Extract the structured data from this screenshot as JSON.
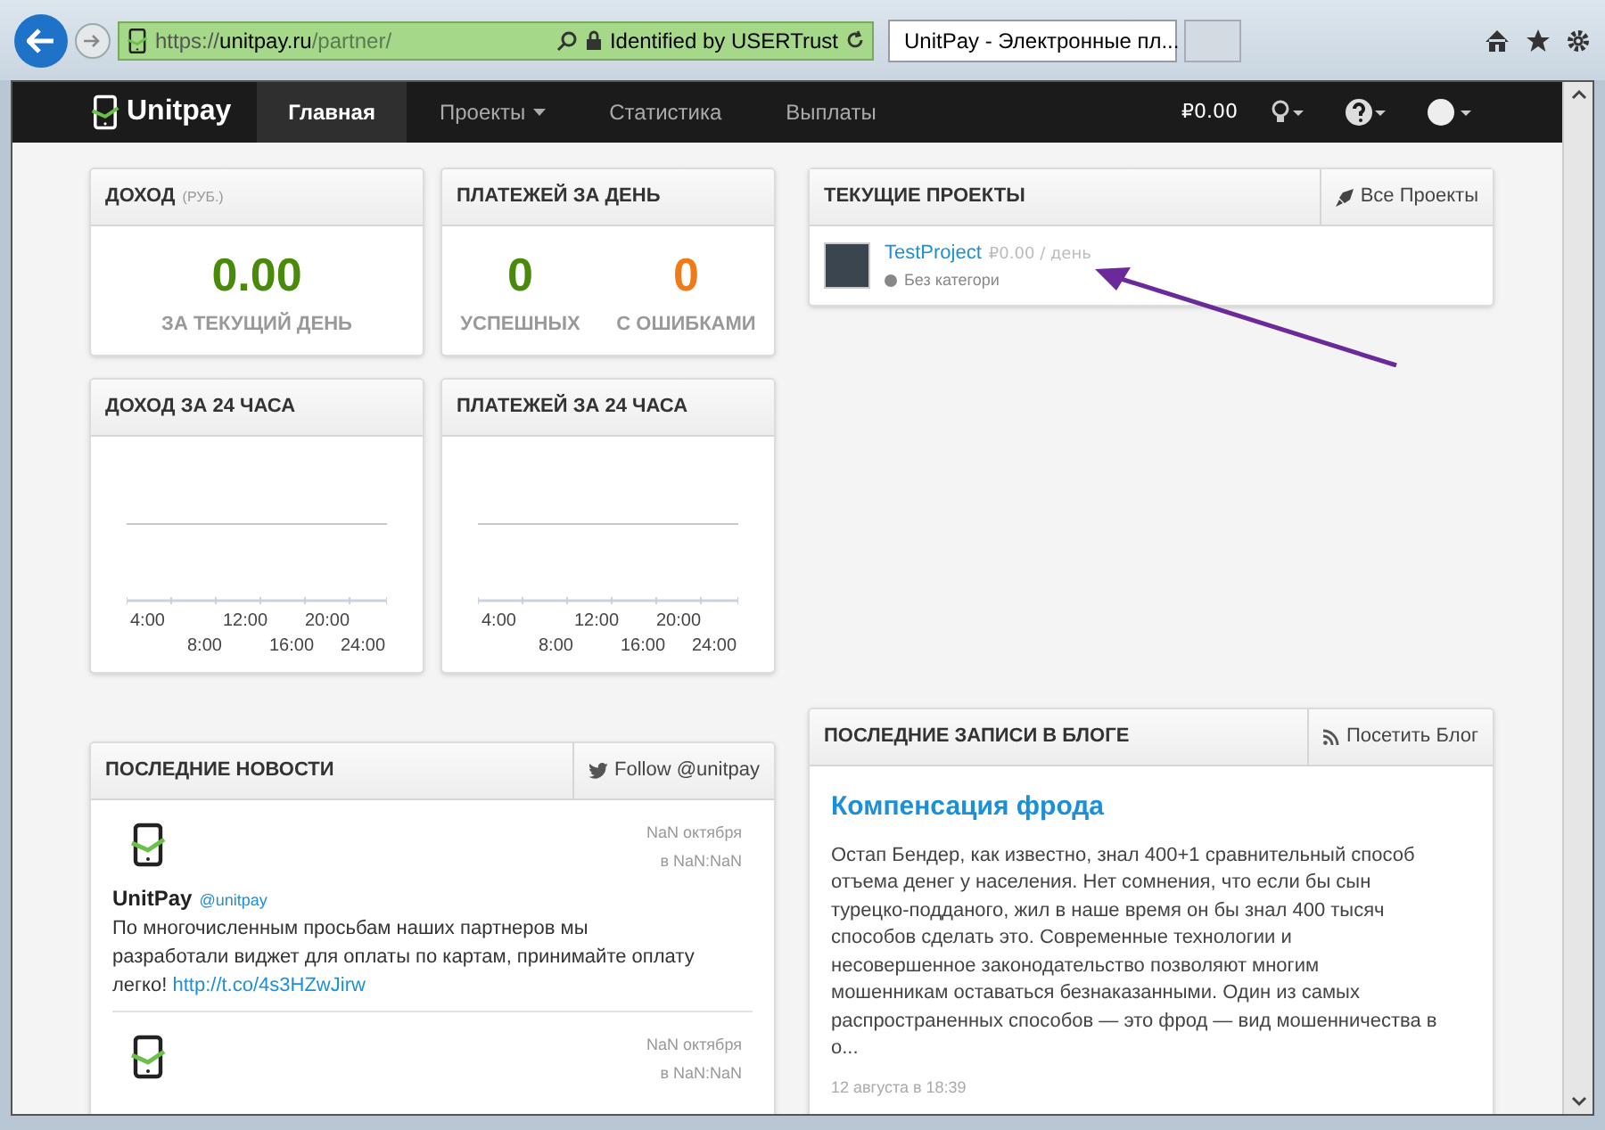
{
  "browser": {
    "address": {
      "scheme": "https://",
      "host": "unitpay.ru",
      "path": "/partner/"
    },
    "identity": "Identified by USERTrust",
    "tab": "UnitPay - Электронные пл..."
  },
  "nav": {
    "logo": "Unitpay",
    "items": [
      {
        "label": "Главная",
        "selected": true,
        "dropdown": false
      },
      {
        "label": "Проекты",
        "selected": false,
        "dropdown": true
      },
      {
        "label": "Статистика",
        "selected": false,
        "dropdown": false
      },
      {
        "label": "Выплаты",
        "selected": false,
        "dropdown": false
      }
    ],
    "balance": "₽0.00"
  },
  "income": {
    "title": "ДОХОД",
    "unit": "(РУБ.)",
    "value": "0.00",
    "caption": "ЗА ТЕКУЩИЙ ДЕНЬ"
  },
  "payments": {
    "title": "ПЛАТЕЖЕЙ ЗА ДЕНЬ",
    "stats": [
      {
        "value": "0",
        "caption": "УСПЕШНЫХ",
        "color": "#4a8a0a"
      },
      {
        "value": "0",
        "caption": "С ОШИБКАМИ",
        "color": "#f07a18"
      }
    ]
  },
  "charts": [
    {
      "title": "ДОХОД ЗА 24 ЧАСА",
      "x_labels": [
        "4:00",
        "8:00",
        "12:00",
        "16:00",
        "20:00",
        "24:00"
      ]
    },
    {
      "title": "ПЛАТЕЖЕЙ ЗА 24 ЧАСА",
      "x_labels": [
        "4:00",
        "8:00",
        "12:00",
        "16:00",
        "20:00",
        "24:00"
      ]
    }
  ],
  "projects": {
    "title": "ТЕКУЩИЕ ПРОЕКТЫ",
    "action": "Все Проекты",
    "items": [
      {
        "name": "TestProject",
        "amount": "₽0.00",
        "per": "/ день",
        "category": "Без категори"
      }
    ]
  },
  "news": {
    "title": "ПОСЛЕДНИЕ НОВОСТИ",
    "action": "Follow @unitpay",
    "tweets": [
      {
        "date": "NaN октября",
        "time": "в NaN:NaN",
        "author": "UnitPay",
        "handle": "@unitpay",
        "text": "По многочисленным просьбам наших партнеров мы разработали виджет для оплаты по картам, принимайте оплату легко!",
        "link": "http://t.co/4s3HZwJirw"
      },
      {
        "date": "NaN октября",
        "time": "в NaN:NaN"
      }
    ]
  },
  "blog": {
    "title": "ПОСЛЕДНИЕ ЗАПИСИ В БЛОГЕ",
    "action": "Посетить Блог",
    "post": {
      "title": "Компенсация фрода",
      "text": "Остап Бендер, как известно, знал 400+1 сравнительный способ отъема денег у населения. Нет сомнения, что если бы сын турецко-подданого, жил в наше время он бы знал 400 тысяч способов сделать это. Современные технологии и несовершенное законодательство позволяют многим мошенникам оставаться безнаказанными. Один из самых распространенных способов — это фрод — вид мошенничества в о...",
      "date": "12 августа в 18:39"
    }
  }
}
